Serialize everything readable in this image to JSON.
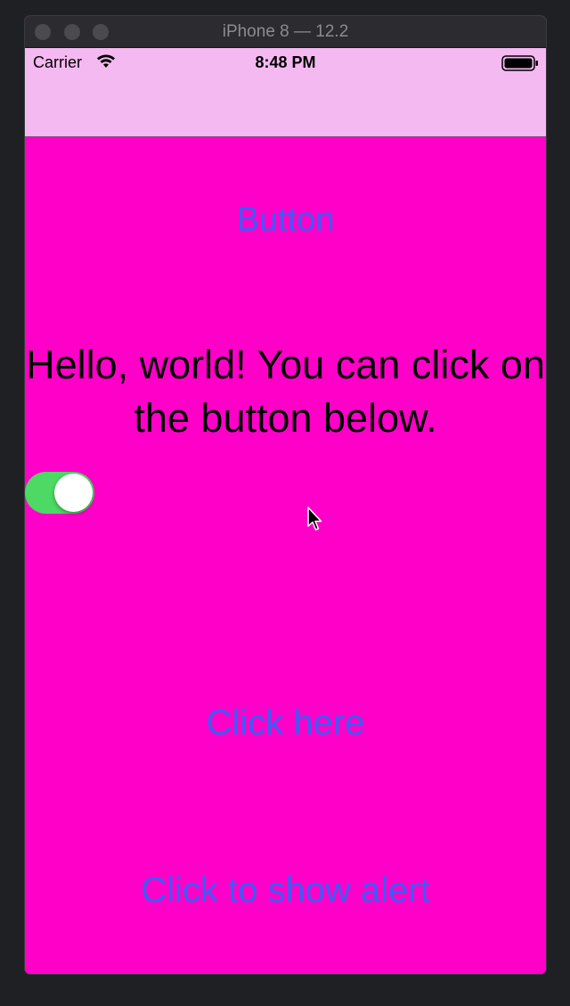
{
  "window": {
    "title": "iPhone 8 — 12.2"
  },
  "status_bar": {
    "carrier": "Carrier",
    "time": "8:48 PM",
    "icons": [
      "wifi-icon",
      "battery-icon"
    ]
  },
  "content": {
    "top_button_label": "Button",
    "headline": "Hello, world! You can click on the button below.",
    "toggle_on": true,
    "click_here_label": "Click here",
    "alert_button_label": "Click to show alert"
  },
  "colors": {
    "content_background": "#ff00c8",
    "navbar_background": "#f5b9f1",
    "link_blue": "#3a5df7",
    "toggle_on_green": "#4cd964"
  }
}
